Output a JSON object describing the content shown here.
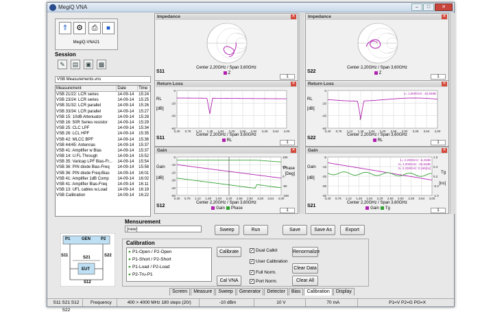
{
  "window": {
    "title": "MegiQ VNA"
  },
  "toolbar": {
    "device_name": "MegiQ-VNA21"
  },
  "session": {
    "label": "Session",
    "file": "VSB Measurements.vns"
  },
  "measure_list": {
    "headers": [
      "Measurement",
      "Date",
      "Time"
    ],
    "rows": [
      [
        "VSB 21/22: LCR series",
        "14-09-14",
        "15:24"
      ],
      [
        "VSB 23/24: LCR series",
        "14-09-14",
        "15:25"
      ],
      [
        "VSB 31/32: LCR parallel",
        "14-09-14",
        "15:26"
      ],
      [
        "VSB 33/34: LCR parallel",
        "14-09-14",
        "15:27"
      ],
      [
        "VSB 15: 10dB Attenuator",
        "14-09-14",
        "15:28"
      ],
      [
        "VSB 16: 50R Series resistor",
        "14-09-14",
        "15:29"
      ],
      [
        "VSB 25: CLC LPF",
        "14-09-14",
        "15:34"
      ],
      [
        "VSB 26: LCL HPF",
        "14-09-14",
        "15:35"
      ],
      [
        "VSB 42: MLCC BPF",
        "14-09-14",
        "15:36"
      ],
      [
        "VSB 44/45: Antennas",
        "14-09-14",
        "15:37"
      ],
      [
        "VSB 41: Amplifier w Bias",
        "14-09-14",
        "15:37"
      ],
      [
        "VSB 14: U.FL Through",
        "14-09-14",
        "15:52"
      ],
      [
        "VSB 35: Varicap LPF Bias-Fr...",
        "14-09-14",
        "15:54"
      ],
      [
        "VSB 36: PIN diode Bias-Freq",
        "14-09-14",
        "15:58"
      ],
      [
        "VSB 36: PIN diode Freq-Bias",
        "14-09-14",
        "16:01"
      ],
      [
        "VSB 41: Amplifier 1dB Comp",
        "14-09-14",
        "16:02"
      ],
      [
        "VSB 41: Amplifier Bias-Freq",
        "14-09-14",
        "16:11"
      ],
      [
        "VSB 13: UFL cables w.Load",
        "14-09-14",
        "16:19"
      ],
      [
        "VSB Calibration",
        "14-09-14",
        "16:22"
      ]
    ]
  },
  "plots": {
    "imp1": {
      "title": "Impedance",
      "port": "S11",
      "center": "Center 2,20GHz / Span 3,60GHz",
      "legend": "Z"
    },
    "imp2": {
      "title": "Impedance",
      "port": "S22",
      "center": "Center 2,20GHz / Span 3,60GHz",
      "legend": "Z"
    },
    "rl1": {
      "title": "Return Loss",
      "port": "S11",
      "center": "Center 2,20GHz / Span 3,60GHz",
      "legend": "RL",
      "ylabel": "RL",
      "yunit": "[dB]",
      "xunit": "F [GHz]"
    },
    "rl2": {
      "title": "Return Loss",
      "port": "S22",
      "center": "Center 2,20GHz / Span 3,60GHz",
      "legend": "RL",
      "ylabel": "RL",
      "yunit": "[dB]",
      "xunit": "F [GHz]",
      "marker": "1= 1,500GHz: -44,59dB"
    },
    "g1": {
      "title": "Gain",
      "port": "S12",
      "center": "Center 2,20GHz / Span 3,60GHz",
      "legend1": "Gain",
      "legend2": "Phase",
      "ylabel": "Gain",
      "yunit": "[dB]",
      "y2label": "Phase",
      "y2unit": "[Deg]",
      "xunit": "F [GHz]"
    },
    "g2": {
      "title": "Gain",
      "port": "S21",
      "center": "Center 2,20GHz / Span 3,60GHz",
      "legend1": "Gain",
      "legend2": "Tg",
      "ylabel": "Gain",
      "yunit": "[dB]",
      "y2label": "Tg",
      "y2unit": "[ns]",
      "xunit": "F [GHz]",
      "m1": "1= 2,200GHz: -6,33dB",
      "m2": "2= 4,000GHz: -33,50dB",
      "m3": "3= 2,200GHz: 0,166[ns]"
    }
  },
  "xticks": [
    "0,40",
    "0,76",
    "1,12",
    "1,48",
    "1,84",
    "2,20",
    "2,56",
    "2,92",
    "3,28",
    "3,64",
    "4,00"
  ],
  "rl_yticks": [
    "0",
    "-20",
    "-40",
    "-60"
  ],
  "g1_yticks": [
    "0",
    "-10",
    "-20",
    "-30",
    "-40",
    "-50"
  ],
  "g1_y2ticks": [
    "180",
    "90",
    "0",
    "-90",
    "-180"
  ],
  "g2_yticks": [
    "-5",
    "-15",
    "-25",
    "-35",
    "-45"
  ],
  "g2_y2ticks": [
    "1.0",
    "0.4",
    "0.2",
    "-0.4",
    "-1.0"
  ],
  "page_ctl": "1",
  "measurement": {
    "label": "Mensurement",
    "value": "[new]",
    "sweep": "Sweep",
    "run": "Run",
    "save": "Save",
    "save_as": "Save As",
    "export": "Export"
  },
  "diagram": {
    "p1": "P1",
    "gen": "GEN",
    "p2": "P2",
    "s11": "S11",
    "s21": "S21",
    "s22": "S22",
    "eut": "EUT",
    "s12": "S12"
  },
  "calibration": {
    "label": "Calibration",
    "steps": [
      "P1-Open / P2-Open",
      "P1-Short / P2-Short",
      "P1-Load / P2-Load",
      "P2-Tru-P1"
    ],
    "calibrate": "Calibrate",
    "cal_vna": "Cal VNA",
    "dual_calkit": "Dual Calkit",
    "user_cal": "User Calibration",
    "full_norm": "Full Norm.",
    "port_norm": "Port Norm.",
    "renormalize": "Renormalize",
    "clear_data": "Clear Data",
    "clear_all": "Clear All"
  },
  "tabs": [
    "Screen",
    "Measure",
    "Sweep",
    "Generator",
    "Detector",
    "Bias",
    "Calibration",
    "Display"
  ],
  "status": [
    "S11 S21 S12 S22",
    "Frequency",
    "400 > 4000 MHz 180 steps (20/)",
    "-10 dBm",
    "10 V",
    "70 mA",
    "P1=V P2=G PG=X"
  ],
  "colors": {
    "trace": "#b020b0",
    "phase": "#30a030",
    "grid": "#c8c8c8"
  }
}
